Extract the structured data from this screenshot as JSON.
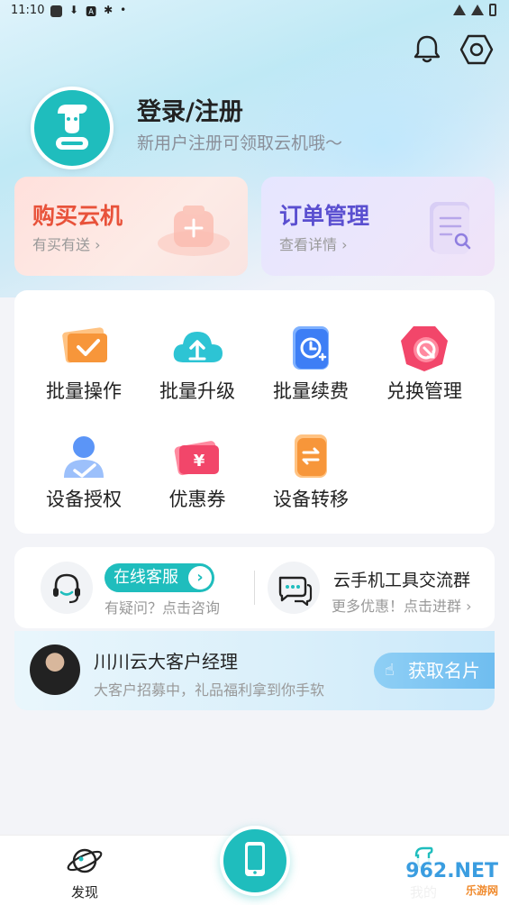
{
  "status_bar": {
    "time": "11:10",
    "icons": [
      "app-icon",
      "download-icon",
      "a-icon",
      "notify-icon",
      "dot"
    ]
  },
  "header": {
    "bell_icon": "bell-icon",
    "settings_icon": "hexagon-settings-icon"
  },
  "profile": {
    "title": "登录/注册",
    "subtitle": "新用户注册可领取云机哦～"
  },
  "cards": {
    "buy": {
      "title": "购买云机",
      "subtitle": "有买有送 ›"
    },
    "orders": {
      "title": "订单管理",
      "subtitle": "查看详情 ›"
    }
  },
  "grid": {
    "items": [
      {
        "label": "批量操作",
        "icon": "batch-operate-icon",
        "color": "#f79a3e"
      },
      {
        "label": "批量升级",
        "icon": "batch-upgrade-icon",
        "color": "#2dc4d4"
      },
      {
        "label": "批量续费",
        "icon": "batch-renew-icon",
        "color": "#3d7ef5"
      },
      {
        "label": "兑换管理",
        "icon": "redeem-icon",
        "color": "#f2466a"
      },
      {
        "label": "设备授权",
        "icon": "device-auth-icon",
        "color": "#3d7ef5"
      },
      {
        "label": "优惠券",
        "icon": "coupon-icon",
        "color": "#f2466a"
      },
      {
        "label": "设备转移",
        "icon": "device-transfer-icon",
        "color": "#f79a3e"
      }
    ]
  },
  "service": {
    "online": {
      "label": "在线客服",
      "sub": "有疑问？点击咨询"
    },
    "group": {
      "title": "云手机工具交流群",
      "sub": "更多优惠！点击进群 ›"
    }
  },
  "manager": {
    "name": "川川云大客户经理",
    "sub": "大客户招募中，礼品福利拿到你手软",
    "button": "获取名片"
  },
  "bottom_nav": {
    "discover": "发现",
    "mine": "我的"
  },
  "watermark": {
    "text": "962.NET",
    "sub": "乐游网"
  },
  "colors": {
    "accent": "#1fbdbd",
    "buy": "#e8523a",
    "order": "#5a4fd0"
  }
}
